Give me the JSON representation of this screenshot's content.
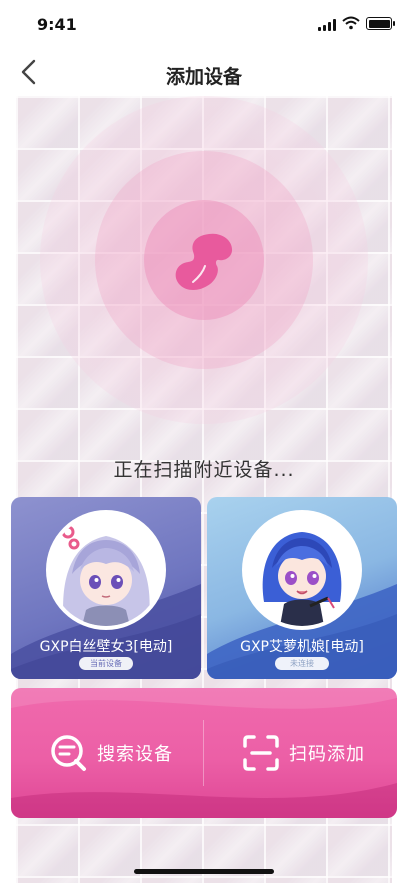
{
  "status_bar": {
    "time": "9:41"
  },
  "nav": {
    "title": "添加设备",
    "back_icon": "chevron-left-icon"
  },
  "scan": {
    "status_text": "正在扫描附近设备...",
    "logo_icon": "bluetooth-logo-icon"
  },
  "devices": [
    {
      "name": "GXP白丝壁女3[电动]",
      "status": "当前设备",
      "avatar": "anime-girl-lavender-hair"
    },
    {
      "name": "GXP艾萝机娘[电动]",
      "status": "未连接",
      "avatar": "anime-girl-blue-hair"
    }
  ],
  "actions": {
    "search_label": "搜索设备",
    "search_icon": "search-list-icon",
    "scan_label": "扫码添加",
    "scan_icon": "scan-qr-icon"
  },
  "colors": {
    "accent_pink": "#ec5fa6",
    "card_left": "#6f76c0",
    "card_right": "#8ab7e3"
  }
}
